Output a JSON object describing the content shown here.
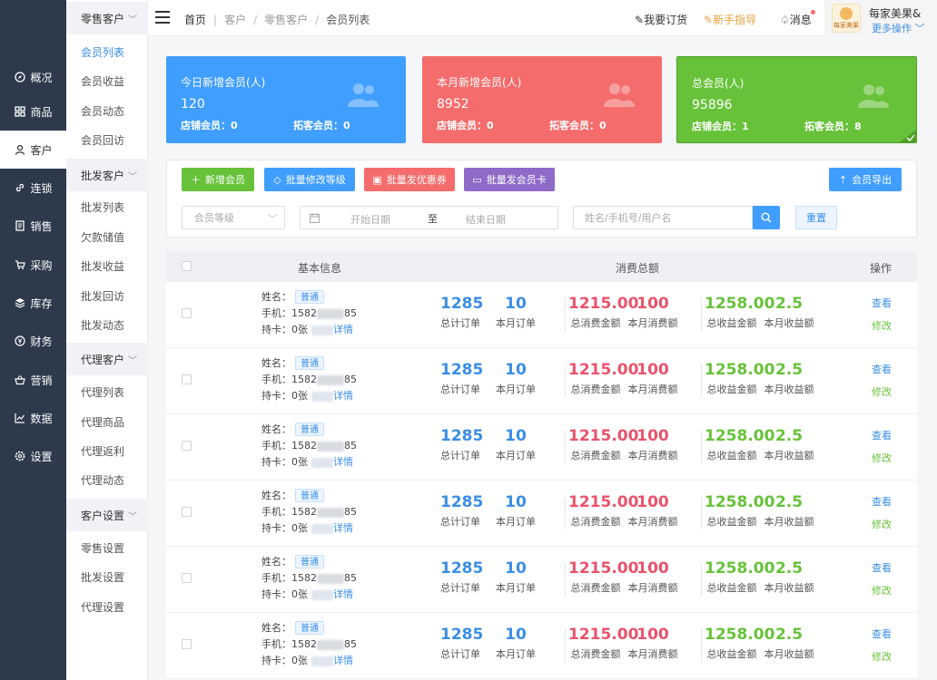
{
  "nav": {
    "items": [
      {
        "label": "概况",
        "icon": "compass-icon"
      },
      {
        "label": "商品",
        "icon": "grid-icon"
      },
      {
        "label": "客户",
        "icon": "user-icon"
      },
      {
        "label": "连锁",
        "icon": "link-icon"
      },
      {
        "label": "销售",
        "icon": "document-icon"
      },
      {
        "label": "采购",
        "icon": "cart-icon"
      },
      {
        "label": "库存",
        "icon": "layers-icon"
      },
      {
        "label": "财务",
        "icon": "yen-icon"
      },
      {
        "label": "营销",
        "icon": "basket-icon"
      },
      {
        "label": "数据",
        "icon": "chart-line-icon"
      },
      {
        "label": "设置",
        "icon": "gear-icon"
      }
    ],
    "active_index": 2
  },
  "submenu": {
    "groups": [
      {
        "label": "零售客户",
        "items": [
          "会员列表",
          "会员收益",
          "会员动态",
          "会员回访"
        ]
      },
      {
        "label": "批发客户",
        "items": [
          "批发列表",
          "欠款储值",
          "批发收益",
          "批发回访",
          "批发动态"
        ]
      },
      {
        "label": "代理客户",
        "items": [
          "代理列表",
          "代理商品",
          "代理返利",
          "代理动态"
        ]
      },
      {
        "label": "客户设置",
        "items": [
          "零售设置",
          "批发设置",
          "代理设置"
        ]
      }
    ],
    "active_item": "会员列表"
  },
  "topbar": {
    "breadcrumbs": [
      "首页",
      "客户",
      "零售客户",
      "会员列表"
    ],
    "order_label": "我要订货",
    "guide_label": "新手指导",
    "message_label": "消息",
    "user_name": "每家美果&",
    "more_label": "更多操作",
    "avatar_text": "每家美果"
  },
  "stats": [
    {
      "title": "今日新增会员(人)",
      "value": "120",
      "store_label": "店铺会员：",
      "store_value": "0",
      "expand_label": "拓客会员：",
      "expand_value": "0",
      "color": "#409eff"
    },
    {
      "title": "本月新增会员(人)",
      "value": "8952",
      "store_label": "店铺会员：",
      "store_value": "0",
      "expand_label": "拓客会员：",
      "expand_value": "0",
      "color": "#f56c6c"
    },
    {
      "title": "总会员(人)",
      "value": "95896",
      "store_label": "店铺会员：",
      "store_value": "1",
      "expand_label": "拓客会员：",
      "expand_value": "8",
      "color": "#67c23a"
    }
  ],
  "toolbar": {
    "add_label": "新增会员",
    "batch_level_label": "批量修改等级",
    "batch_coupon_label": "批量发优惠券",
    "batch_card_label": "批量发会员卡",
    "export_label": "会员导出",
    "colors": {
      "green": "#67c23a",
      "blue": "#409eff",
      "red": "#f56c6c",
      "purple": "#8e6bc9"
    }
  },
  "filters": {
    "level_placeholder": "会员等级",
    "start_placeholder": "开始日期",
    "range_sep": "至",
    "end_placeholder": "结束日期",
    "search_placeholder": "姓名/手机号/用户名",
    "reset_label": "重置"
  },
  "table": {
    "headers": {
      "basic": "基本信息",
      "consume": "消费总额",
      "action": "操作"
    },
    "labels": {
      "name": "姓名：",
      "phone": "手机：",
      "card": "持卡：",
      "detail": "详情",
      "total_orders": "总计订单",
      "month_orders": "本月订单",
      "total_spend": "总消费金额",
      "month_spend": "本月消费额",
      "total_income": "总收益金额",
      "month_income": "本月收益额",
      "view": "查看",
      "edit": "修改"
    },
    "rows": [
      {
        "level": "普通",
        "phone_prefix": "1582",
        "phone_suffix": "85",
        "cards": "0张",
        "total_orders": "1285",
        "month_orders": "10",
        "total_spend": "1215.00",
        "month_spend": "100",
        "total_income": "1258.00",
        "month_income": "2.5"
      },
      {
        "level": "普通",
        "phone_prefix": "1582",
        "phone_suffix": "85",
        "cards": "0张",
        "total_orders": "1285",
        "month_orders": "10",
        "total_spend": "1215.00",
        "month_spend": "100",
        "total_income": "1258.00",
        "month_income": "2.5"
      },
      {
        "level": "普通",
        "phone_prefix": "1582",
        "phone_suffix": "85",
        "cards": "0张",
        "total_orders": "1285",
        "month_orders": "10",
        "total_spend": "1215.00",
        "month_spend": "100",
        "total_income": "1258.00",
        "month_income": "2.5"
      },
      {
        "level": "普通",
        "phone_prefix": "1582",
        "phone_suffix": "85",
        "cards": "0张",
        "total_orders": "1285",
        "month_orders": "10",
        "total_spend": "1215.00",
        "month_spend": "100",
        "total_income": "1258.00",
        "month_income": "2.5"
      },
      {
        "level": "普通",
        "phone_prefix": "1582",
        "phone_suffix": "85",
        "cards": "0张",
        "total_orders": "1285",
        "month_orders": "10",
        "total_spend": "1215.00",
        "month_spend": "100",
        "total_income": "1258.00",
        "month_income": "2.5"
      },
      {
        "level": "普通",
        "phone_prefix": "1582",
        "phone_suffix": "85",
        "cards": "0张",
        "total_orders": "1285",
        "month_orders": "10",
        "total_spend": "1215.00",
        "month_spend": "100",
        "total_income": "1258.00",
        "month_income": "2.5"
      }
    ]
  }
}
